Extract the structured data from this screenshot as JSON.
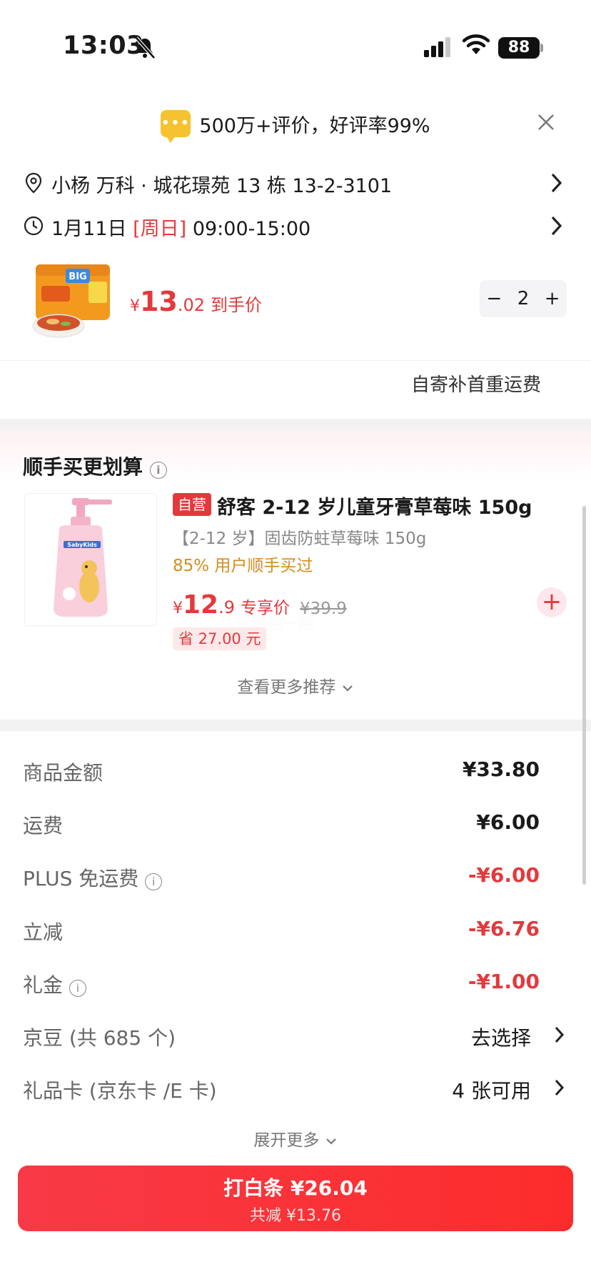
{
  "status_bar": {
    "time": "13:03",
    "battery": "88"
  },
  "banner": {
    "rating_text": "500万+评价，好评率99%"
  },
  "address": {
    "text": "小杨  万科 · 城花璟苑 13 栋 13-2-3101"
  },
  "delivery": {
    "date": "1月11日",
    "weekday": "[周日]",
    "window": "09:00-15:00"
  },
  "product": {
    "currency": "¥",
    "price_int": "13",
    "price_dec": ".02",
    "price_label": "到手价",
    "quantity": "2",
    "minus": "−",
    "plus": "+"
  },
  "shipping_note": "自寄补首重运费",
  "recommend": {
    "title": "顺手买更划算",
    "tag": "自营",
    "name": "舒客 2-12 岁儿童牙膏草莓味 150g",
    "subtitle": "【2-12 岁】固齿防蛀草莓味 150g",
    "bought": "85% 用户顺手买过",
    "currency": "¥",
    "price_int": "12",
    "price_dec": ".9",
    "price_label": "专享价",
    "original": "¥39.9",
    "save": "省 27.00 元",
    "add": "+",
    "more": "查看更多推荐",
    "image_brand": "SabyKids",
    "watermark": "你看我一眼"
  },
  "summary": {
    "rows": [
      {
        "label": "商品金额",
        "value": "¥33.80"
      },
      {
        "label": "运费",
        "value": "¥6.00"
      },
      {
        "label": "PLUS 免运费",
        "value": "-¥6.00"
      },
      {
        "label": "立减",
        "value": "-¥6.76"
      },
      {
        "label": "礼金",
        "value": "-¥1.00"
      },
      {
        "label": "京豆 (共 685 个)",
        "value": "去选择"
      },
      {
        "label": "礼品卡 (京东卡 /E 卡)",
        "value": "4 张可用"
      }
    ],
    "expand": "展开更多"
  },
  "pay": {
    "main": "打白条 ¥26.04",
    "sub": "共减 ¥13.76"
  },
  "colors": {
    "accent_red": "#e4393c",
    "bought_orange": "#d48d1e",
    "chat_yellow": "#f7c22f"
  }
}
